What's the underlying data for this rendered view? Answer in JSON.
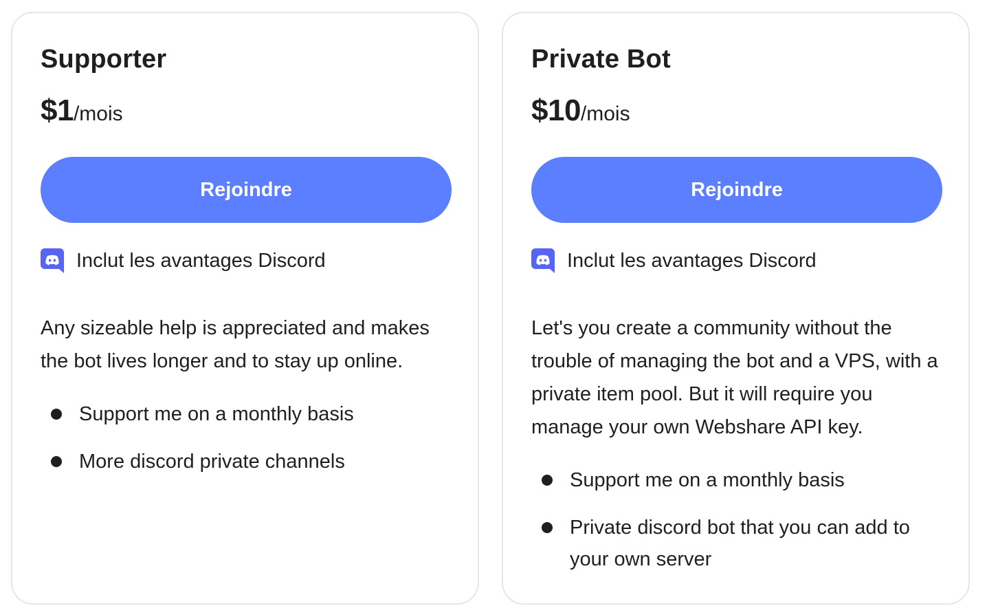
{
  "tiers": [
    {
      "title": "Supporter",
      "price": "$1",
      "period": "/mois",
      "button_label": "Rejoindre",
      "perk": "Inclut les avantages Discord",
      "perk_icon": "discord-icon",
      "description": "Any sizeable help is appreciated and makes the bot lives longer and to stay up online.",
      "features": [
        "Support me on a monthly basis",
        "More discord private channels"
      ]
    },
    {
      "title": "Private Bot",
      "price": "$10",
      "period": "/mois",
      "button_label": "Rejoindre",
      "perk": "Inclut les avantages Discord",
      "perk_icon": "discord-icon",
      "description": "Let's you create a community without the trouble of managing the bot and a VPS, with a private item pool. But it will require you manage your own Webshare API key.",
      "features": [
        "Support me on a monthly basis",
        "Private discord bot that you can add to your own server"
      ]
    }
  ],
  "colors": {
    "accent": "#5b7fff",
    "discord": "#5865f2",
    "text": "#1f1f1f",
    "border": "#e6e6e6"
  }
}
